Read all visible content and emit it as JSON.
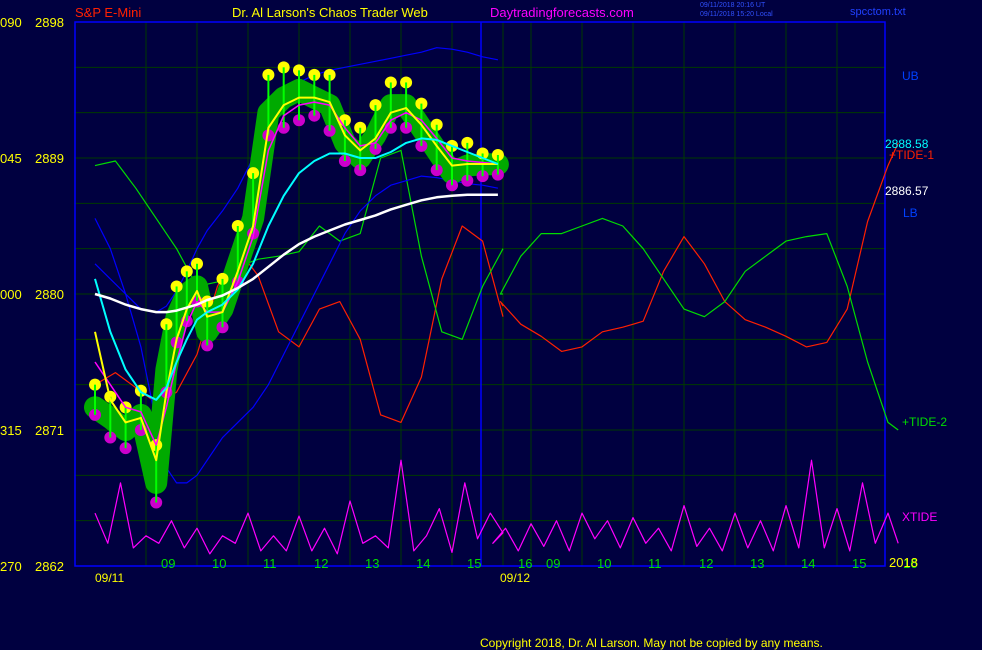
{
  "header": {
    "symbol": "S&P E-Mini",
    "author": "Dr. Al Larson's Chaos Trader Web",
    "site": "Daytradingforecasts.com",
    "timestamp_ut": "09/11/2018 20:16 UT",
    "timestamp_local": "09/11/2018 15:20 Local",
    "filename": "spcctom.txt"
  },
  "footer": {
    "copyright": "Copyright 2018, Dr. Al Larson. May not be copied by any means."
  },
  "colors": {
    "background": "#000040",
    "grid": "#003a00",
    "frame": "#0000ff",
    "price_highlight": "#00aa00",
    "bars": "#00ff00",
    "fast_ma": "#ffff00",
    "mid_ma": "#ff00ff",
    "slow_ma": "#00ffff",
    "long_ma": "#ffffff",
    "bands": "#0000ff",
    "tide1": "#ff2000",
    "tide2": "#00dd00",
    "xtide": "#ff00ff",
    "yellow_dot": "#ffff00",
    "magenta_dot": "#cc00cc"
  },
  "chart_data": {
    "type": "line",
    "title": "S&P E-Mini",
    "y_axis": {
      "price_ticks": [
        "2898",
        "2889",
        "2880",
        "2871",
        "2862"
      ],
      "left_ticks": [
        "090",
        "045",
        "000",
        "315",
        "270"
      ],
      "ylim": [
        2862,
        2898
      ]
    },
    "x_axis": {
      "day1_label": "09/11",
      "day2_label": "09/12",
      "year_label": "2018",
      "hours_day1": [
        "09",
        "10",
        "11",
        "12",
        "13",
        "14",
        "15",
        "16"
      ],
      "hours_day2": [
        "09",
        "10",
        "11",
        "12",
        "13",
        "14",
        "15",
        "16"
      ]
    },
    "price_labels": [
      {
        "text": "2888.58",
        "value": 2888.58
      },
      {
        "text": "2886.57",
        "value": 2886.57
      }
    ],
    "series_labels": {
      "upper_band": "UB",
      "lower_band": "LB",
      "tide1": "+TIDE-1",
      "tide2": "+TIDE-2",
      "xtide": "XTIDE"
    },
    "price_hours": [
      8.0,
      8.3,
      8.6,
      8.9,
      9.2,
      9.4,
      9.6,
      9.8,
      10.0,
      10.2,
      10.5,
      10.8,
      11.1,
      11.4,
      11.7,
      12.0,
      12.3,
      12.6,
      12.9,
      13.2,
      13.5,
      13.8,
      14.1,
      14.4,
      14.7,
      15.0,
      15.3,
      15.6,
      15.9
    ],
    "close": [
      2872.5,
      2871.8,
      2871.0,
      2872.0,
      2867.5,
      2875.0,
      2878.5,
      2880.0,
      2880.5,
      2877.5,
      2879.0,
      2882.0,
      2885.0,
      2892.0,
      2893.0,
      2893.5,
      2893.0,
      2892.5,
      2890.0,
      2889.0,
      2890.5,
      2892.5,
      2892.5,
      2891.0,
      2889.5,
      2888.0,
      2888.5,
      2888.58,
      2888.58
    ],
    "highs": [
      2874.0,
      2873.2,
      2872.5,
      2873.6,
      2870.0,
      2878.0,
      2880.5,
      2881.5,
      2882.0,
      2879.5,
      2881.0,
      2884.5,
      2888.0,
      2894.5,
      2895.0,
      2894.8,
      2894.5,
      2894.5,
      2891.5,
      2891.0,
      2892.5,
      2894.0,
      2894.0,
      2892.6,
      2891.2,
      2889.8,
      2890.0,
      2889.3,
      2889.2
    ],
    "lows": [
      2872.0,
      2870.5,
      2869.8,
      2871.0,
      2866.2,
      2873.5,
      2876.8,
      2878.2,
      2879.5,
      2876.6,
      2877.8,
      2880.8,
      2884.0,
      2890.5,
      2891.0,
      2891.5,
      2891.8,
      2890.8,
      2888.8,
      2888.2,
      2889.6,
      2891.0,
      2891.0,
      2889.8,
      2888.2,
      2887.2,
      2887.5,
      2887.8,
      2887.9
    ],
    "ma_fast": [
      2877.5,
      2873.0,
      2871.5,
      2871.8,
      2869.0,
      2873.5,
      2877.0,
      2879.0,
      2880.2,
      2878.5,
      2878.8,
      2881.5,
      2884.5,
      2891.0,
      2892.5,
      2893.0,
      2893.0,
      2892.7,
      2890.5,
      2889.5,
      2890.3,
      2892.0,
      2892.3,
      2891.2,
      2889.8,
      2888.5,
      2888.6,
      2888.6,
      2888.6
    ],
    "ma_mid": [
      2875.5,
      2874.0,
      2872.5,
      2872.2,
      2870.0,
      2872.5,
      2875.5,
      2878.0,
      2879.5,
      2878.8,
      2878.8,
      2880.8,
      2883.8,
      2889.5,
      2891.8,
      2892.5,
      2892.7,
      2892.5,
      2891.0,
      2889.8,
      2890.0,
      2891.5,
      2892.0,
      2891.5,
      2890.3,
      2889.0,
      2888.8,
      2888.7,
      2888.6
    ],
    "ma_slow": [
      2881.0,
      2877.5,
      2875.0,
      2873.5,
      2873.0,
      2873.8,
      2875.5,
      2877.0,
      2878.3,
      2878.8,
      2879.3,
      2880.3,
      2882.0,
      2884.5,
      2886.5,
      2888.0,
      2888.8,
      2889.3,
      2889.3,
      2889.0,
      2889.0,
      2889.4,
      2890.0,
      2890.3,
      2890.2,
      2889.8,
      2889.4,
      2889.0,
      2888.6
    ],
    "ma_long": [
      2880.0,
      2879.7,
      2879.3,
      2879.0,
      2878.8,
      2878.8,
      2878.9,
      2879.1,
      2879.3,
      2879.6,
      2879.9,
      2880.4,
      2881.0,
      2881.8,
      2882.6,
      2883.3,
      2883.8,
      2884.2,
      2884.6,
      2884.9,
      2885.2,
      2885.6,
      2885.9,
      2886.2,
      2886.4,
      2886.5,
      2886.57,
      2886.57,
      2886.57
    ],
    "upper_band": [
      2882.0,
      2881.0,
      2880.0,
      2879.0,
      2878.8,
      2879.2,
      2880.2,
      2881.5,
      2883.0,
      2884.2,
      2885.5,
      2887.0,
      2889.0,
      2891.5,
      2893.3,
      2894.0,
      2894.5,
      2894.8,
      2895.0,
      2895.2,
      2895.4,
      2895.6,
      2895.8,
      2896.0,
      2896.3,
      2896.2,
      2896.0,
      2895.7,
      2895.5
    ],
    "lower_band": [
      2885.0,
      2883.0,
      2880.0,
      2876.5,
      2871.5,
      2868.5,
      2867.5,
      2867.5,
      2868.0,
      2869.0,
      2870.5,
      2871.5,
      2872.5,
      2874.0,
      2876.0,
      2878.0,
      2880.0,
      2882.0,
      2884.0,
      2885.5,
      2886.5,
      2887.2,
      2887.5,
      2887.8,
      2887.7,
      2887.5,
      2887.3,
      2887.2,
      2887.0
    ],
    "tide_hours": [
      8.0,
      8.4,
      8.8,
      9.2,
      9.6,
      10.0,
      10.4,
      10.8,
      11.2,
      11.6,
      12.0,
      12.4,
      12.8,
      13.2,
      13.6,
      14.0,
      14.4,
      14.8,
      15.2,
      15.6,
      16.0,
      16.0,
      16.4,
      16.8,
      17.2,
      17.6,
      18.0,
      18.4,
      18.8,
      19.2,
      19.6,
      20.0,
      20.4,
      20.8,
      21.2,
      21.6,
      22.0,
      22.4,
      22.8,
      23.2,
      23.6,
      24.0,
      24.2
    ],
    "tide1": [
      2874.0,
      2874.8,
      2873.8,
      2872.8,
      2873.5,
      2876.0,
      2880.5,
      2883.0,
      2881.2,
      2877.5,
      2876.5,
      2879.0,
      2879.5,
      2877.0,
      2872.0,
      2871.5,
      2874.5,
      2881.0,
      2884.5,
      2883.5,
      2878.5,
      2879.2,
      2879.5,
      2878.0,
      2877.2,
      2876.2,
      2876.5,
      2877.5,
      2877.8,
      2878.2,
      2881.5,
      2883.8,
      2882.0,
      2879.5,
      2878.3,
      2877.8,
      2877.2,
      2876.5,
      2876.8,
      2879.0,
      2884.8,
      2888.5,
      2890.0
    ],
    "tide2": [
      2888.5,
      2888.8,
      2887.0,
      2885.0,
      2883.0,
      2880.5,
      2880.8,
      2881.8,
      2882.3,
      2882.5,
      2882.8,
      2884.5,
      2883.5,
      2884.0,
      2889.0,
      2889.5,
      2882.5,
      2877.5,
      2877.0,
      2880.5,
      2883.0,
      2880.0,
      2880.0,
      2882.5,
      2884.0,
      2884.0,
      2884.5,
      2885.0,
      2884.5,
      2883.0,
      2881.0,
      2879.0,
      2878.5,
      2879.5,
      2881.5,
      2882.5,
      2883.5,
      2883.8,
      2884.0,
      2880.5,
      2875.5,
      2871.5,
      2871.0
    ],
    "xtide_hours": [
      8.0,
      8.25,
      8.5,
      8.75,
      9.0,
      9.25,
      9.5,
      9.75,
      10.0,
      10.25,
      10.5,
      10.75,
      11.0,
      11.25,
      11.5,
      11.75,
      12.0,
      12.25,
      12.5,
      12.75,
      13.0,
      13.25,
      13.5,
      13.75,
      14.0,
      14.25,
      14.5,
      14.75,
      15.0,
      15.25,
      15.5,
      15.75,
      16.0,
      16.25,
      16.5,
      16.75,
      17.0,
      17.25,
      17.5,
      17.75,
      18.0,
      18.25,
      18.5,
      18.75,
      19.0,
      19.25,
      19.5,
      19.75,
      20.0,
      20.25,
      20.5,
      20.75,
      21.0,
      21.25,
      21.5,
      21.75,
      22.0,
      22.25,
      22.5,
      22.75,
      23.0,
      23.25,
      23.5,
      23.75,
      24.0,
      24.2
    ],
    "xtide": [
      2865.5,
      2863.5,
      2867.5,
      2863.2,
      2864.0,
      2863.5,
      2865.0,
      2863.2,
      2864.5,
      2862.8,
      2864.0,
      2863.5,
      2865.5,
      2863.0,
      2864.0,
      2863.0,
      2865.3,
      2863.0,
      2864.5,
      2862.8,
      2866.3,
      2863.5,
      2864.0,
      2863.2,
      2869.0,
      2863.0,
      2864.0,
      2865.8,
      2862.9,
      2867.5,
      2863.8,
      2865.5,
      2864.2,
      2863.5,
      2864.5,
      2863.0,
      2864.8,
      2863.3,
      2865.0,
      2863.0,
      2865.5,
      2863.8,
      2865.0,
      2863.2,
      2865.2,
      2863.5,
      2864.5,
      2863.0,
      2866.0,
      2863.3,
      2864.5,
      2863.0,
      2865.5,
      2863.2,
      2865.0,
      2863.0,
      2866.0,
      2863.2,
      2869.0,
      2863.2,
      2865.8,
      2863.0,
      2867.5,
      2863.5,
      2865.5,
      2863.5
    ]
  }
}
